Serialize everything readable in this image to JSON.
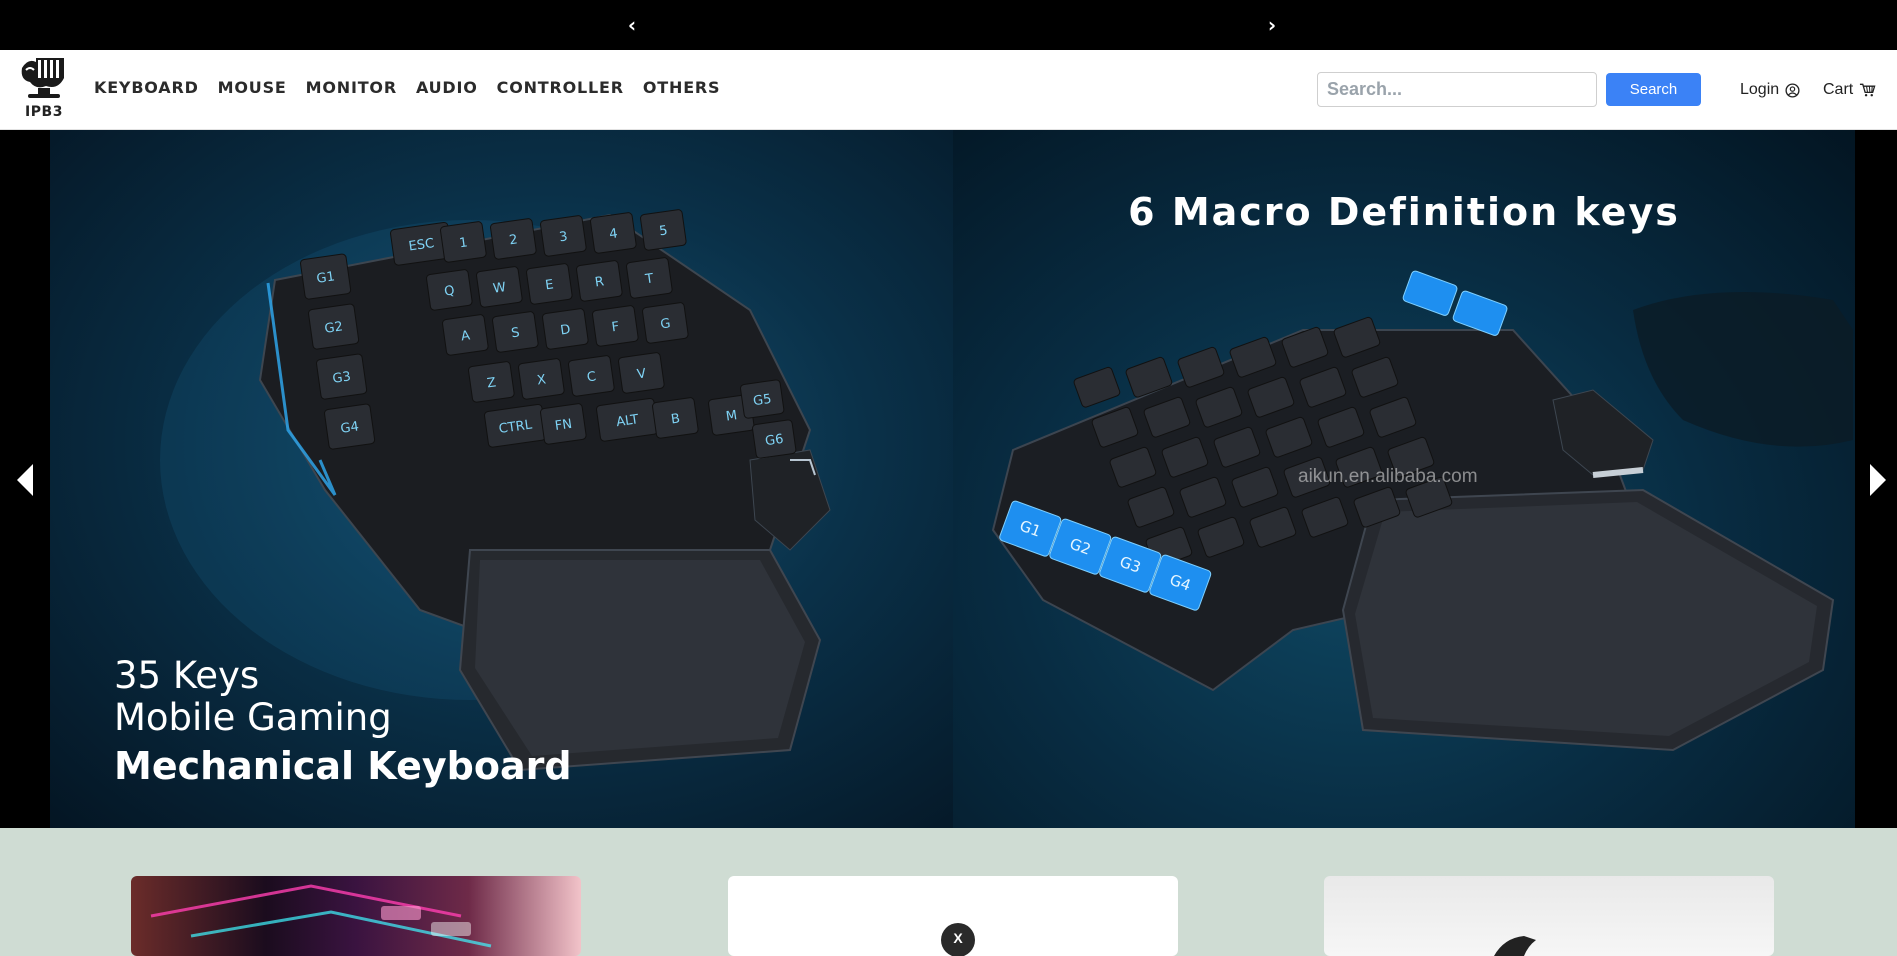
{
  "topbar": {
    "prev_icon": "chevron-left-icon",
    "next_icon": "chevron-right-icon"
  },
  "brand": {
    "logo_text": "IPB3"
  },
  "nav": {
    "items": [
      {
        "label": "KEYBOARD"
      },
      {
        "label": "MOUSE"
      },
      {
        "label": "MONITOR"
      },
      {
        "label": "AUDIO"
      },
      {
        "label": "CONTROLLER"
      },
      {
        "label": "OTHERS"
      }
    ]
  },
  "search": {
    "placeholder": "Search...",
    "value": "",
    "button_label": "Search"
  },
  "account": {
    "login_label": "Login",
    "login_icon": "user-circle-icon",
    "cart_label": "Cart",
    "cart_icon": "cart-icon"
  },
  "hero": {
    "slide1": {
      "line1": "35 Keys",
      "line2": "Mobile Gaming",
      "line3": "Mechanical Keyboard",
      "key_rows": [
        [
          "ESC",
          "1",
          "2",
          "3",
          "4",
          "5"
        ],
        [
          "Q",
          "W",
          "E",
          "R",
          "T"
        ],
        [
          "A",
          "S",
          "D",
          "F",
          "G"
        ],
        [
          "Z",
          "X",
          "C",
          "V"
        ],
        [
          "CTRL",
          "FN",
          "ALT",
          "B",
          "M"
        ]
      ],
      "macro_keys": [
        "G1",
        "G2",
        "G3",
        "G4"
      ],
      "side_keys": [
        "G5",
        "G6"
      ]
    },
    "slide2": {
      "title": "6 Macro Definition keys",
      "watermark": "aikun.en.alibaba.com",
      "macro_keys": [
        "G1",
        "G2",
        "G3",
        "G4"
      ]
    },
    "prev_icon": "triangle-left-icon",
    "next_icon": "triangle-right-icon"
  },
  "cards": [
    {
      "name": "rgb-keyboard-card"
    },
    {
      "name": "controller-card",
      "badge": "X"
    },
    {
      "name": "mouse-card"
    }
  ],
  "colors": {
    "accent": "#3b82f6",
    "page_background": "#cfdcd3",
    "topbar": "#000000",
    "macro_key_blue": "#1e8ff0"
  }
}
